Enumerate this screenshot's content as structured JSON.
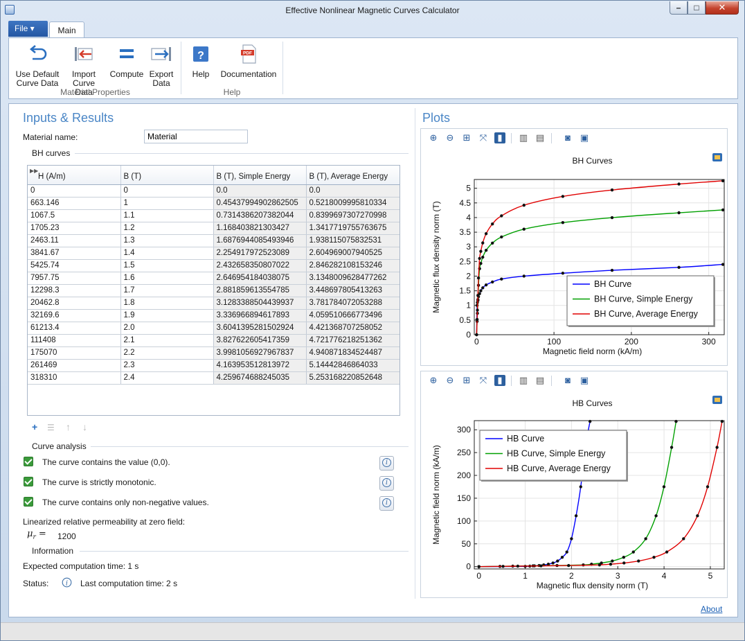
{
  "window": {
    "title": "Effective Nonlinear Magnetic Curves Calculator"
  },
  "ribbon": {
    "file_tab": "File ▾",
    "main_tab": "Main",
    "buttons": {
      "use_default": "Use Default\nCurve Data",
      "import": "Import\nCurve Data",
      "compute": "Compute",
      "export": "Export\nData",
      "help": "Help",
      "documentation": "Documentation"
    },
    "groups": {
      "material": "Material Properties",
      "help": "Help"
    }
  },
  "inputs": {
    "title": "Inputs & Results",
    "material_label": "Material name:",
    "material_value": "Material",
    "bh_section": "BH curves",
    "table": {
      "headers": [
        "H (A/m)",
        "B (T)",
        "B (T), Simple Energy",
        "B (T), Average Energy"
      ],
      "rows": [
        [
          "0",
          "0",
          "0.0",
          "0.0"
        ],
        [
          "663.146",
          "1",
          "0.45437994902862505",
          "0.5218009995810334"
        ],
        [
          "1067.5",
          "1.1",
          "0.7314386207382044",
          "0.8399697307270998"
        ],
        [
          "1705.23",
          "1.2",
          "1.168403821303427",
          "1.3417719755763675"
        ],
        [
          "2463.11",
          "1.3",
          "1.6876944085493946",
          "1.938115075832531"
        ],
        [
          "3841.67",
          "1.4",
          "2.254917972523089",
          "2.604969007940525"
        ],
        [
          "5425.74",
          "1.5",
          "2.432658350807022",
          "2.846282108153246"
        ],
        [
          "7957.75",
          "1.6",
          "2.646954184038075",
          "3.1348009628477262"
        ],
        [
          "12298.3",
          "1.7",
          "2.881859613554785",
          "3.448697805413263"
        ],
        [
          "20462.8",
          "1.8",
          "3.1283388504439937",
          "3.781784072053288"
        ],
        [
          "32169.6",
          "1.9",
          "3.336966894617893",
          "4.059510666773496"
        ],
        [
          "61213.4",
          "2.0",
          "3.6041395281502924",
          "4.421368707258052"
        ],
        [
          "111408",
          "2.1",
          "3.827622605417359",
          "4.721776218251362"
        ],
        [
          "175070",
          "2.2",
          "3.9981056927967837",
          "4.940871834524487"
        ],
        [
          "261469",
          "2.3",
          "4.163953512813972",
          "5.14442846864033"
        ],
        [
          "318310",
          "2.4",
          "4.259674688245035",
          "5.253168220852648"
        ]
      ]
    },
    "curve_analysis": {
      "title": "Curve analysis",
      "checks": [
        "The curve contains the value (0,0).",
        "The curve is strictly monotonic.",
        "The curve contains only non-negative values."
      ]
    },
    "permeability": {
      "label": "Linearized relative permeability at zero field:",
      "symbol": "μ",
      "subscript": "r",
      "equals": "=",
      "value": "1200"
    },
    "information": {
      "title": "Information",
      "expected": "Expected computation time: 1 s",
      "status_label": "Status:",
      "status_value": "Last computation time: 2 s"
    }
  },
  "plots": {
    "title": "Plots",
    "about": "About"
  },
  "chart_data": [
    {
      "type": "line",
      "title": "BH Curves",
      "xlabel": "Magnetic field norm (kA/m)",
      "ylabel": "Magnetic flux density norm (T)",
      "xlim": [
        -3,
        320
      ],
      "ylim": [
        0,
        5.3
      ],
      "xticks": [
        0,
        100,
        200,
        300
      ],
      "yticks": [
        0,
        0.5,
        1,
        1.5,
        2,
        2.5,
        3,
        3.5,
        4,
        4.5,
        5
      ],
      "grid": true,
      "legend": "right",
      "x": [
        0,
        0.663146,
        1.0675,
        1.70523,
        2.46311,
        3.84167,
        5.42574,
        7.95775,
        12.2983,
        20.4628,
        32.1696,
        61.2134,
        111.408,
        175.07,
        261.469,
        318.31
      ],
      "series": [
        {
          "name": "BH Curve",
          "color": "#0000ff",
          "values": [
            0,
            1,
            1.1,
            1.2,
            1.3,
            1.4,
            1.5,
            1.6,
            1.7,
            1.8,
            1.9,
            2.0,
            2.1,
            2.2,
            2.3,
            2.4
          ]
        },
        {
          "name": "BH Curve, Simple Energy",
          "color": "#00a000",
          "values": [
            0,
            0.4544,
            0.7314,
            1.1684,
            1.6877,
            2.2549,
            2.4327,
            2.647,
            2.8819,
            3.1283,
            3.337,
            3.6041,
            3.8276,
            3.9981,
            4.164,
            4.2597
          ]
        },
        {
          "name": "BH Curve, Average Energy",
          "color": "#e00000",
          "values": [
            0,
            0.5218,
            0.84,
            1.3418,
            1.9381,
            2.605,
            2.8463,
            3.1348,
            3.4487,
            3.7818,
            4.0595,
            4.4214,
            4.7218,
            4.9409,
            5.1444,
            5.2532
          ]
        }
      ]
    },
    {
      "type": "line",
      "title": "HB Curves",
      "xlabel": "Magnetic flux density norm (T)",
      "ylabel": "Magnetic field norm (kA/m)",
      "xlim": [
        -0.1,
        5.3
      ],
      "ylim": [
        -5,
        320
      ],
      "xticks": [
        0,
        1,
        2,
        3,
        4,
        5
      ],
      "yticks": [
        0,
        50,
        100,
        150,
        200,
        250,
        300
      ],
      "grid": true,
      "legend": "top-left",
      "y": [
        0,
        0.663146,
        1.0675,
        1.70523,
        2.46311,
        3.84167,
        5.42574,
        7.95775,
        12.2983,
        20.4628,
        32.1696,
        61.2134,
        111.408,
        175.07,
        261.469,
        318.31
      ],
      "series": [
        {
          "name": "HB Curve",
          "color": "#0000ff",
          "values": [
            0,
            1,
            1.1,
            1.2,
            1.3,
            1.4,
            1.5,
            1.6,
            1.7,
            1.8,
            1.9,
            2.0,
            2.1,
            2.2,
            2.3,
            2.4
          ]
        },
        {
          "name": "HB Curve, Simple Energy",
          "color": "#00a000",
          "values": [
            0,
            0.4544,
            0.7314,
            1.1684,
            1.6877,
            2.2549,
            2.4327,
            2.647,
            2.8819,
            3.1283,
            3.337,
            3.6041,
            3.8276,
            3.9981,
            4.164,
            4.2597
          ]
        },
        {
          "name": "HB Curve, Average Energy",
          "color": "#e00000",
          "values": [
            0,
            0.5218,
            0.84,
            1.3418,
            1.9381,
            2.605,
            2.8463,
            3.1348,
            3.4487,
            3.7818,
            4.0595,
            4.4214,
            4.7218,
            4.9409,
            5.1444,
            5.2532
          ]
        }
      ]
    }
  ]
}
